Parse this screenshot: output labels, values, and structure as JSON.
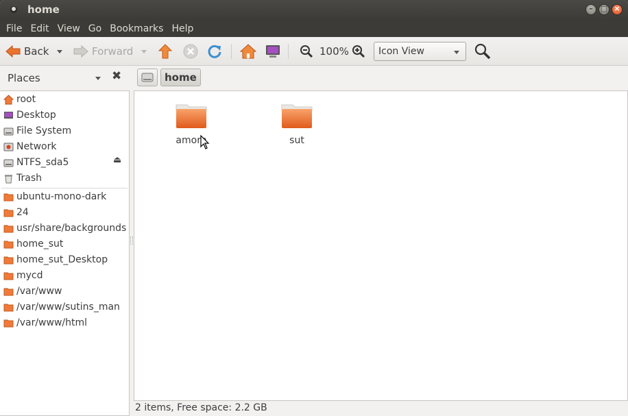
{
  "window": {
    "title": "home"
  },
  "menu": [
    "File",
    "Edit",
    "View",
    "Go",
    "Bookmarks",
    "Help"
  ],
  "toolbar": {
    "back_label": "Back",
    "forward_label": "Forward",
    "zoom_level": "100%",
    "view_mode": "Icon View"
  },
  "sidebar": {
    "header": "Places",
    "places": [
      {
        "label": "root",
        "icon": "home-icon"
      },
      {
        "label": "Desktop",
        "icon": "desktop-icon"
      },
      {
        "label": "File System",
        "icon": "drive-icon"
      },
      {
        "label": "Network",
        "icon": "network-icon"
      },
      {
        "label": "NTFS_sda5",
        "icon": "drive-icon"
      },
      {
        "label": "Trash",
        "icon": "trash-icon"
      }
    ],
    "bookmarks": [
      "ubuntu-mono-dark",
      "24",
      "usr/share/backgrounds",
      "home_sut",
      "home_sut_Desktop",
      "mycd",
      "/var/www",
      "/var/www/sutins_man",
      "/var/www/html"
    ]
  },
  "breadcrumb": {
    "current": "home"
  },
  "files": [
    {
      "name": "amorn",
      "type": "folder"
    },
    {
      "name": "sut",
      "type": "folder"
    }
  ],
  "status": {
    "text": "2 items, Free space: 2.2 GB"
  },
  "colors": {
    "accent": "#dd4814",
    "titlebar": "#3c3b37",
    "folder": "#f07746"
  }
}
